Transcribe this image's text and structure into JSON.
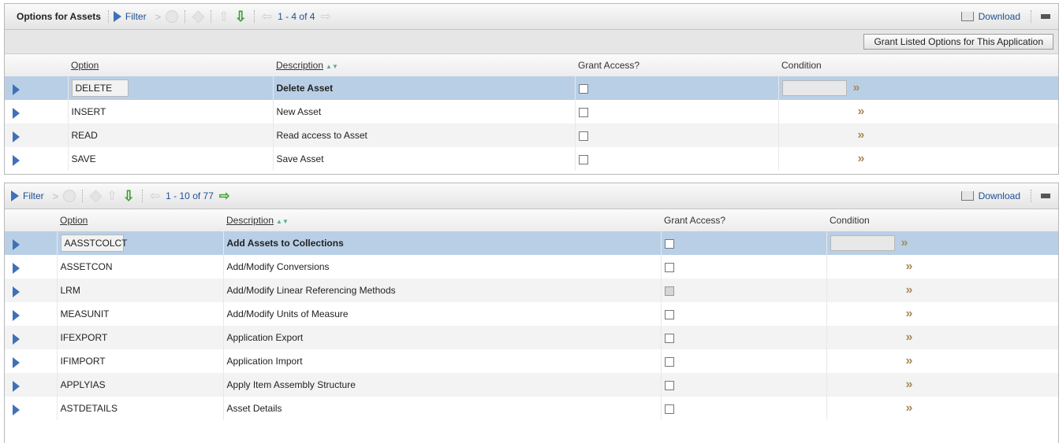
{
  "panel1": {
    "title": "Options for Assets",
    "filter_label": "Filter",
    "count": "1 - 4 of 4",
    "download_label": "Download",
    "grant_button": "Grant Listed Options for This Application",
    "columns": {
      "option": "Option",
      "description": "Description",
      "grant": "Grant Access?",
      "condition": "Condition"
    },
    "rows": [
      {
        "option": "DELETE",
        "description": "Delete Asset"
      },
      {
        "option": "INSERT",
        "description": "New Asset"
      },
      {
        "option": "READ",
        "description": "Read access to Asset"
      },
      {
        "option": "SAVE",
        "description": "Save Asset"
      }
    ]
  },
  "panel2": {
    "filter_label": "Filter",
    "count": "1 - 10 of 77",
    "download_label": "Download",
    "columns": {
      "option": "Option",
      "description": "Description",
      "grant": "Grant Access?",
      "condition": "Condition"
    },
    "rows": [
      {
        "option": "AASSTCOLCT",
        "description": "Add Assets to Collections"
      },
      {
        "option": "ASSETCON",
        "description": "Add/Modify Conversions"
      },
      {
        "option": "LRM",
        "description": "Add/Modify Linear Referencing Methods"
      },
      {
        "option": "MEASUNIT",
        "description": "Add/Modify Units of Measure"
      },
      {
        "option": "IFEXPORT",
        "description": "Application Export"
      },
      {
        "option": "IFIMPORT",
        "description": "Application Import"
      },
      {
        "option": "APPLYIAS",
        "description": "Apply Item Assembly Structure"
      },
      {
        "option": "ASTDETAILS",
        "description": "Asset Details"
      }
    ]
  },
  "icons": {
    "next": "»",
    "sort": "sort-ascending-icon"
  },
  "colors": {
    "selected_row": "#b9cfe6",
    "link": "#1f4f91",
    "next_arrow": "#37a02a"
  }
}
